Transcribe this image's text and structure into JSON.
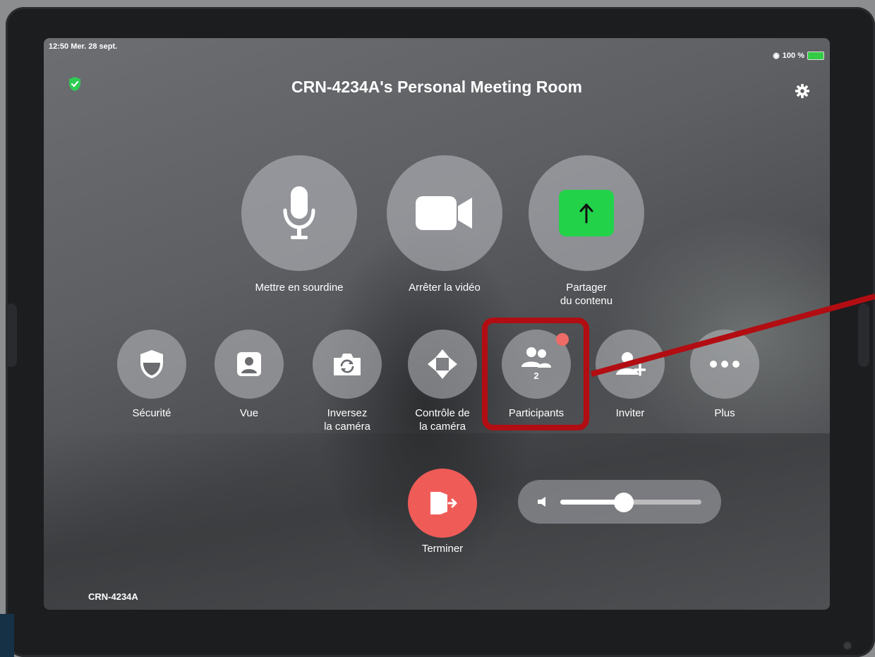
{
  "status_bar": {
    "time_date": "12:50  Mer. 28 sept.",
    "battery": "100 %"
  },
  "header": {
    "title": "CRN-4234A's Personal Meeting Room"
  },
  "main_controls": [
    {
      "label": "Mettre en sourdine",
      "icon": "microphone-icon"
    },
    {
      "label": "Arrêter la vidéo",
      "icon": "video-camera-icon"
    },
    {
      "label": "Partager\ndu contenu",
      "icon": "share-up-arrow-icon"
    }
  ],
  "secondary_controls": [
    {
      "label": "Sécurité",
      "icon": "shield-icon"
    },
    {
      "label": "Vue",
      "icon": "person-view-icon"
    },
    {
      "label": "Inversez\nla caméra",
      "icon": "camera-flip-icon"
    },
    {
      "label": "Contrôle de\nla caméra",
      "icon": "move-arrows-icon"
    },
    {
      "label": "Participants",
      "icon": "participants-icon",
      "count": "2"
    },
    {
      "label": "Inviter",
      "icon": "add-person-icon"
    },
    {
      "label": "Plus",
      "icon": "more-dots-icon"
    }
  ],
  "end_call": {
    "label": "Terminer",
    "icon": "exit-door-icon"
  },
  "volume": {
    "level": 0.45,
    "icon": "speaker-icon"
  },
  "footer": {
    "room_id": "CRN-4234A"
  },
  "colors": {
    "share_green": "#22d34a",
    "end_red": "#ef5b57",
    "security_green": "#2ecc52",
    "annotation_red": "#b20d12",
    "notification_dot": "#ee6b67"
  }
}
